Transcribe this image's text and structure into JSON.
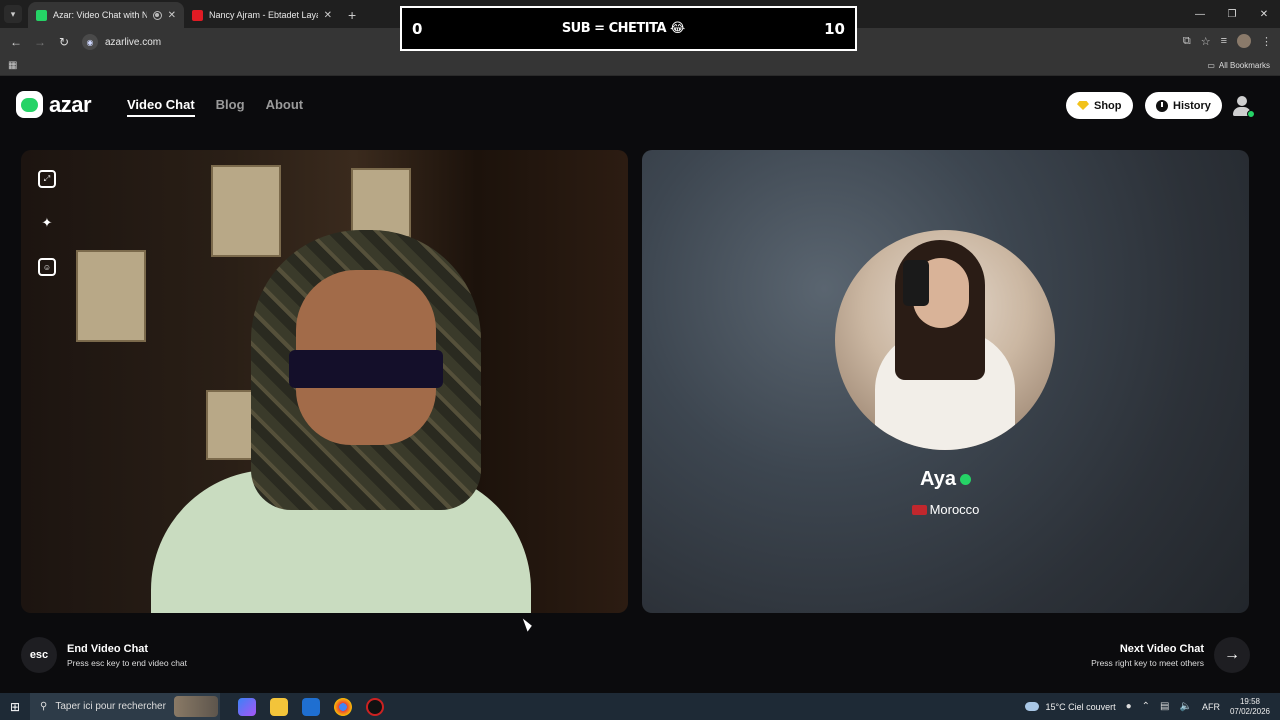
{
  "browser": {
    "tabs": [
      {
        "title": "Azar: Video Chat with New",
        "favicon_color": "#25d366",
        "active": true
      },
      {
        "title": "Nancy Ajram - Ebtadet Layalina",
        "favicon_color": "#e01b24",
        "active": false
      }
    ],
    "new_tab_icon": "plus-icon",
    "address": "azarlive.com",
    "bookmarks_label": "All Bookmarks"
  },
  "overlay": {
    "left_score": "0",
    "middle_text": "SUB = CHETITA 😂",
    "right_score": "10"
  },
  "site": {
    "logo_text": "azar",
    "nav": [
      {
        "label": "Video Chat",
        "active": true
      },
      {
        "label": "Blog",
        "active": false
      },
      {
        "label": "About",
        "active": false
      }
    ],
    "shop_label": "Shop",
    "history_label": "History",
    "accent": "#25d366"
  },
  "peer": {
    "name": "Aya",
    "country": "Morocco",
    "flag_color": "#c1272d"
  },
  "controls": {
    "end_key": "esc",
    "end_title": "End Video Chat",
    "end_hint": "Press esc key to end video chat",
    "next_title": "Next Video Chat",
    "next_hint": "Press right key to meet others",
    "next_icon": "arrow-right-icon"
  },
  "taskbar": {
    "search_placeholder": "Taper ici pour rechercher",
    "weather": "15°C  Ciel couvert",
    "language": "AFR",
    "time": "19:58",
    "date": "07/02/2026"
  }
}
